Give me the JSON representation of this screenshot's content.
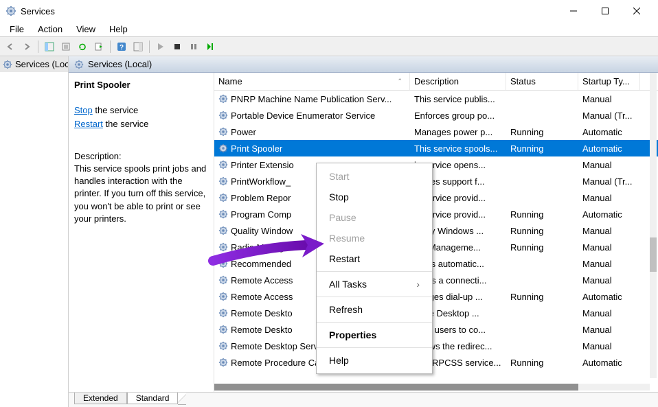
{
  "window": {
    "title": "Services"
  },
  "menubar": [
    "File",
    "Action",
    "View",
    "Help"
  ],
  "tree": {
    "root": "Services (Local)"
  },
  "right_header": "Services (Local)",
  "detail": {
    "title": "Print Spooler",
    "link_stop": "Stop",
    "stop_suffix": " the service",
    "link_restart": "Restart",
    "restart_suffix": " the service",
    "desc_label": "Description:",
    "desc_text": "This service spools print jobs and handles interaction with the printer.  If you turn off this service, you won't be able to print or see your printers."
  },
  "columns": {
    "name": "Name",
    "description": "Description",
    "status": "Status",
    "startup": "Startup Ty..."
  },
  "rows": [
    {
      "name": "PNRP Machine Name Publication Serv...",
      "desc": "This service publis...",
      "status": "",
      "startup": "Manual"
    },
    {
      "name": "Portable Device Enumerator Service",
      "desc": "Enforces group po...",
      "status": "",
      "startup": "Manual (Tr..."
    },
    {
      "name": "Power",
      "desc": "Manages power p...",
      "status": "Running",
      "startup": "Automatic"
    },
    {
      "name": "Print Spooler",
      "desc": "This service spools...",
      "status": "Running",
      "startup": "Automatic",
      "selected": true
    },
    {
      "name": "Printer Extensio",
      "desc": "is service opens...",
      "status": "",
      "startup": "Manual"
    },
    {
      "name": "PrintWorkflow_",
      "desc": "ovides support f...",
      "status": "",
      "startup": "Manual (Tr..."
    },
    {
      "name": "Problem Repor",
      "desc": "is service provid...",
      "status": "",
      "startup": "Manual"
    },
    {
      "name": "Program Comp",
      "desc": "is service provid...",
      "status": "Running",
      "startup": "Automatic"
    },
    {
      "name": "Quality Window",
      "desc": "uality Windows ...",
      "status": "Running",
      "startup": "Manual"
    },
    {
      "name": "Radio Manager",
      "desc": "dio Manageme...",
      "status": "Running",
      "startup": "Manual"
    },
    {
      "name": "Recommended",
      "desc": "ables automatic...",
      "status": "",
      "startup": "Manual"
    },
    {
      "name": "Remote Access",
      "desc": "eates a connecti...",
      "status": "",
      "startup": "Manual"
    },
    {
      "name": "Remote Access",
      "desc": "anages dial-up ...",
      "status": "Running",
      "startup": "Automatic"
    },
    {
      "name": "Remote Deskto",
      "desc": "mote Desktop ...",
      "status": "",
      "startup": "Manual"
    },
    {
      "name": "Remote Deskto",
      "desc": "lows users to co...",
      "status": "",
      "startup": "Manual"
    },
    {
      "name": "Remote Desktop Services UserMode P...",
      "desc": "Allows the redirec...",
      "status": "",
      "startup": "Manual"
    },
    {
      "name": "Remote Procedure Call (RPC)",
      "desc": "The RPCSS service...",
      "status": "Running",
      "startup": "Automatic"
    }
  ],
  "tabs": {
    "extended": "Extended",
    "standard": "Standard"
  },
  "context_menu": [
    {
      "label": "Start",
      "disabled": true
    },
    {
      "label": "Stop"
    },
    {
      "label": "Pause",
      "disabled": true
    },
    {
      "label": "Resume",
      "disabled": true
    },
    {
      "label": "Restart"
    },
    {
      "sep": true
    },
    {
      "label": "All Tasks",
      "submenu": true
    },
    {
      "sep": true
    },
    {
      "label": "Refresh"
    },
    {
      "sep": true
    },
    {
      "label": "Properties",
      "bold": true
    },
    {
      "sep": true
    },
    {
      "label": "Help"
    }
  ]
}
